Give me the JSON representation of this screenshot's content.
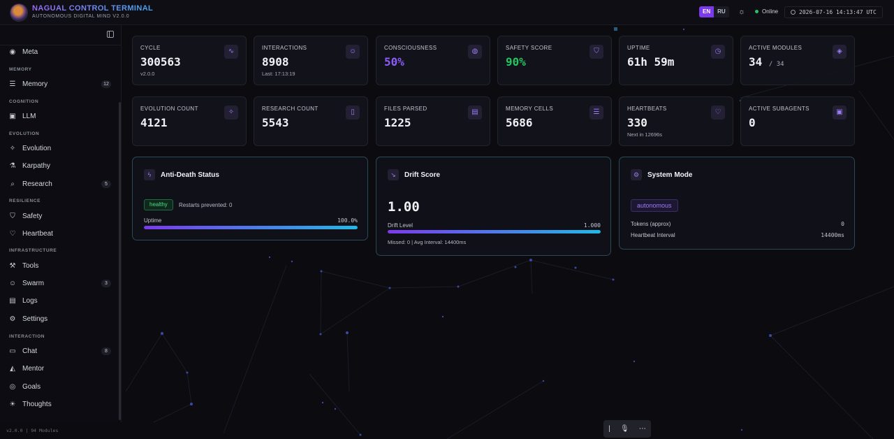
{
  "header": {
    "title": "NAGUAL CONTROL TERMINAL",
    "subtitle": "AUTONOMOUS DIGITAL MIND V2.0.0",
    "lang_en": "EN",
    "lang_ru": "RU",
    "status": "Online",
    "clock": "2026-07-16 14:13:47 UTC"
  },
  "sidebar": {
    "top_item": {
      "label": "Meta",
      "icon": "eye-icon"
    },
    "sections": {
      "memory": "MEMORY",
      "cognition": "COGNITION",
      "evolution": "EVOLUTION",
      "resilience": "RESILIENCE",
      "infrastructure": "INFRASTRUCTURE",
      "interaction": "INTERACTION"
    },
    "items": {
      "memory": {
        "label": "Memory",
        "badge": "12"
      },
      "llm": {
        "label": "LLM"
      },
      "evolution": {
        "label": "Evolution"
      },
      "karpathy": {
        "label": "Karpathy"
      },
      "research": {
        "label": "Research",
        "badge": "5"
      },
      "safety": {
        "label": "Safety"
      },
      "heartbeat": {
        "label": "Heartbeat"
      },
      "tools": {
        "label": "Tools"
      },
      "swarm": {
        "label": "Swarm",
        "badge": "3"
      },
      "logs": {
        "label": "Logs"
      },
      "settings": {
        "label": "Settings"
      },
      "chat": {
        "label": "Chat",
        "badge": "8"
      },
      "mentor": {
        "label": "Mentor"
      },
      "goals": {
        "label": "Goals"
      },
      "thoughts": {
        "label": "Thoughts"
      }
    },
    "footer": "v2.0.0 | 94 Modules"
  },
  "stats": {
    "cycle": {
      "label": "CYCLE",
      "value": "300563",
      "sub": "v2.0.0"
    },
    "interactions": {
      "label": "INTERACTIONS",
      "value": "8908",
      "sub": "Last: 17:13:19"
    },
    "consciousness": {
      "label": "CONSCIOUSNESS",
      "value": "50%"
    },
    "safety": {
      "label": "SAFETY SCORE",
      "value": "90%"
    },
    "uptime": {
      "label": "UPTIME",
      "value": "61h 59m"
    },
    "modules": {
      "label": "ACTIVE MODULES",
      "value": "34",
      "total": "/ 34"
    },
    "evolution_count": {
      "label": "EVOLUTION COUNT",
      "value": "4121"
    },
    "research_count": {
      "label": "RESEARCH COUNT",
      "value": "5543"
    },
    "files": {
      "label": "FILES PARSED",
      "value": "1225"
    },
    "memory_cells": {
      "label": "MEMORY CELLS",
      "value": "5686"
    },
    "heartbeats": {
      "label": "HEARTBEATS",
      "value": "330",
      "sub": "Next in 12696s"
    },
    "subagents": {
      "label": "ACTIVE SUBAGENTS",
      "value": "0"
    }
  },
  "panels": {
    "anti_death": {
      "title": "Anti-Death Status",
      "badge": "healthy",
      "restarts": "Restarts prevented: 0",
      "bar_label": "Uptime",
      "bar_value": "100.0%",
      "bar_fraction": 1.0
    },
    "drift": {
      "title": "Drift Score",
      "value": "1.00",
      "bar_label": "Drift Level",
      "bar_value": "1.000",
      "bar_fraction": 1.0,
      "meta": "Missed: 0 | Avg Interval: 14400ms"
    },
    "system_mode": {
      "title": "System Mode",
      "mode": "autonomous",
      "tokens_label": "Tokens (approx)",
      "tokens_value": "0",
      "interval_label": "Heartbeat Interval",
      "interval_value": "14400ms"
    }
  },
  "colors": {
    "accent": "#7c3aed",
    "accent_secondary": "#22b8e6",
    "success": "#22c55e",
    "background": "#0b0b10"
  }
}
